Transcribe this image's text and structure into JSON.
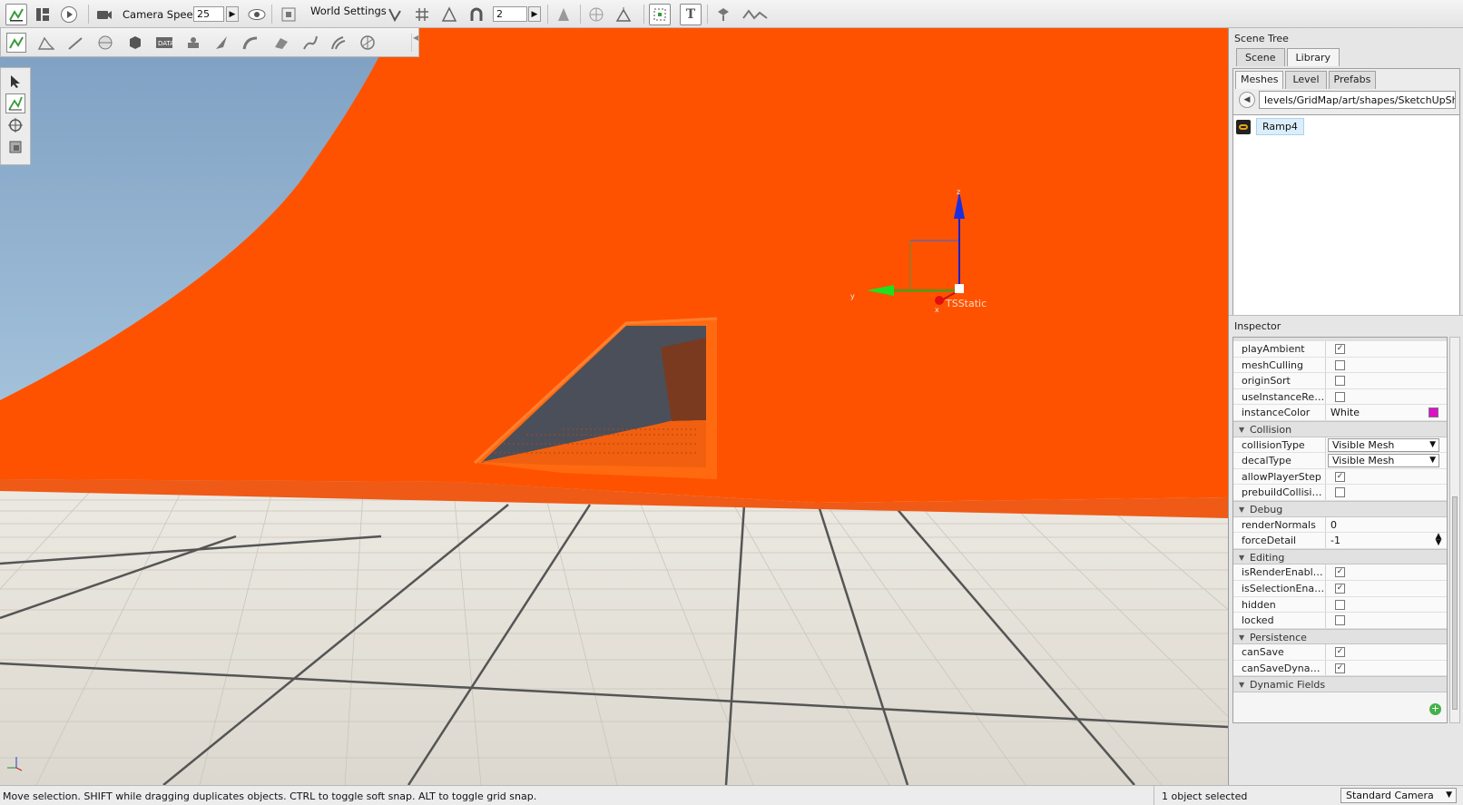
{
  "toolbar": {
    "camera_speed_label": "Camera Speed",
    "camera_speed_value": "25",
    "world_settings_label": "World Settings",
    "snap_value": "2"
  },
  "viewport": {
    "gizmo_label": "TSStatic",
    "axis_z": "z",
    "axis_y": "y",
    "axis_x": "x"
  },
  "scene_tree": {
    "title": "Scene Tree",
    "tabs": [
      "Scene",
      "Library"
    ],
    "active_tab": "Library",
    "subtabs": [
      "Meshes",
      "Level",
      "Prefabs"
    ],
    "path": "levels/GridMap/art/shapes/SketchUpShapes",
    "items": [
      "Ramp4"
    ]
  },
  "inspector": {
    "title": "Inspector",
    "rows": [
      {
        "type": "field",
        "name": "playAmbient",
        "kind": "check",
        "checked": true
      },
      {
        "type": "field",
        "name": "meshCulling",
        "kind": "check",
        "checked": false
      },
      {
        "type": "field",
        "name": "originSort",
        "kind": "check",
        "checked": false
      },
      {
        "type": "field",
        "name": "useInstanceRend...",
        "kind": "check",
        "checked": false
      },
      {
        "type": "field",
        "name": "instanceColor",
        "kind": "color",
        "value": "White",
        "color": "#e010c8"
      },
      {
        "type": "section",
        "name": "Collision"
      },
      {
        "type": "field",
        "name": "collisionType",
        "kind": "dropdown",
        "value": "Visible Mesh"
      },
      {
        "type": "field",
        "name": "decalType",
        "kind": "dropdown",
        "value": "Visible Mesh"
      },
      {
        "type": "field",
        "name": "allowPlayerStep",
        "kind": "check",
        "checked": true
      },
      {
        "type": "field",
        "name": "prebuildCollisionD...",
        "kind": "check",
        "checked": false
      },
      {
        "type": "section",
        "name": "Debug"
      },
      {
        "type": "field",
        "name": "renderNormals",
        "kind": "text",
        "value": "0"
      },
      {
        "type": "field",
        "name": "forceDetail",
        "kind": "spin",
        "value": "-1"
      },
      {
        "type": "section",
        "name": "Editing"
      },
      {
        "type": "field",
        "name": "isRenderEnabled",
        "kind": "check",
        "checked": true
      },
      {
        "type": "field",
        "name": "isSelectionEnabled",
        "kind": "check",
        "checked": true
      },
      {
        "type": "field",
        "name": "hidden",
        "kind": "check",
        "checked": false
      },
      {
        "type": "field",
        "name": "locked",
        "kind": "check",
        "checked": false
      },
      {
        "type": "section",
        "name": "Persistence"
      },
      {
        "type": "field",
        "name": "canSave",
        "kind": "check",
        "checked": true
      },
      {
        "type": "field",
        "name": "canSaveDynamic...",
        "kind": "check",
        "checked": true
      },
      {
        "type": "section",
        "name": "Dynamic Fields"
      }
    ]
  },
  "status": {
    "message": "Move selection.  SHIFT while dragging duplicates objects.  CTRL to toggle soft snap.  ALT to toggle grid snap.",
    "selection": "1 object selected",
    "camera": "Standard Camera"
  },
  "colors": {
    "wall": "#ff5200",
    "sky_top": "#7e9fc2",
    "sky_bottom": "#c9e4f3",
    "floor": "#e8e5dd"
  }
}
